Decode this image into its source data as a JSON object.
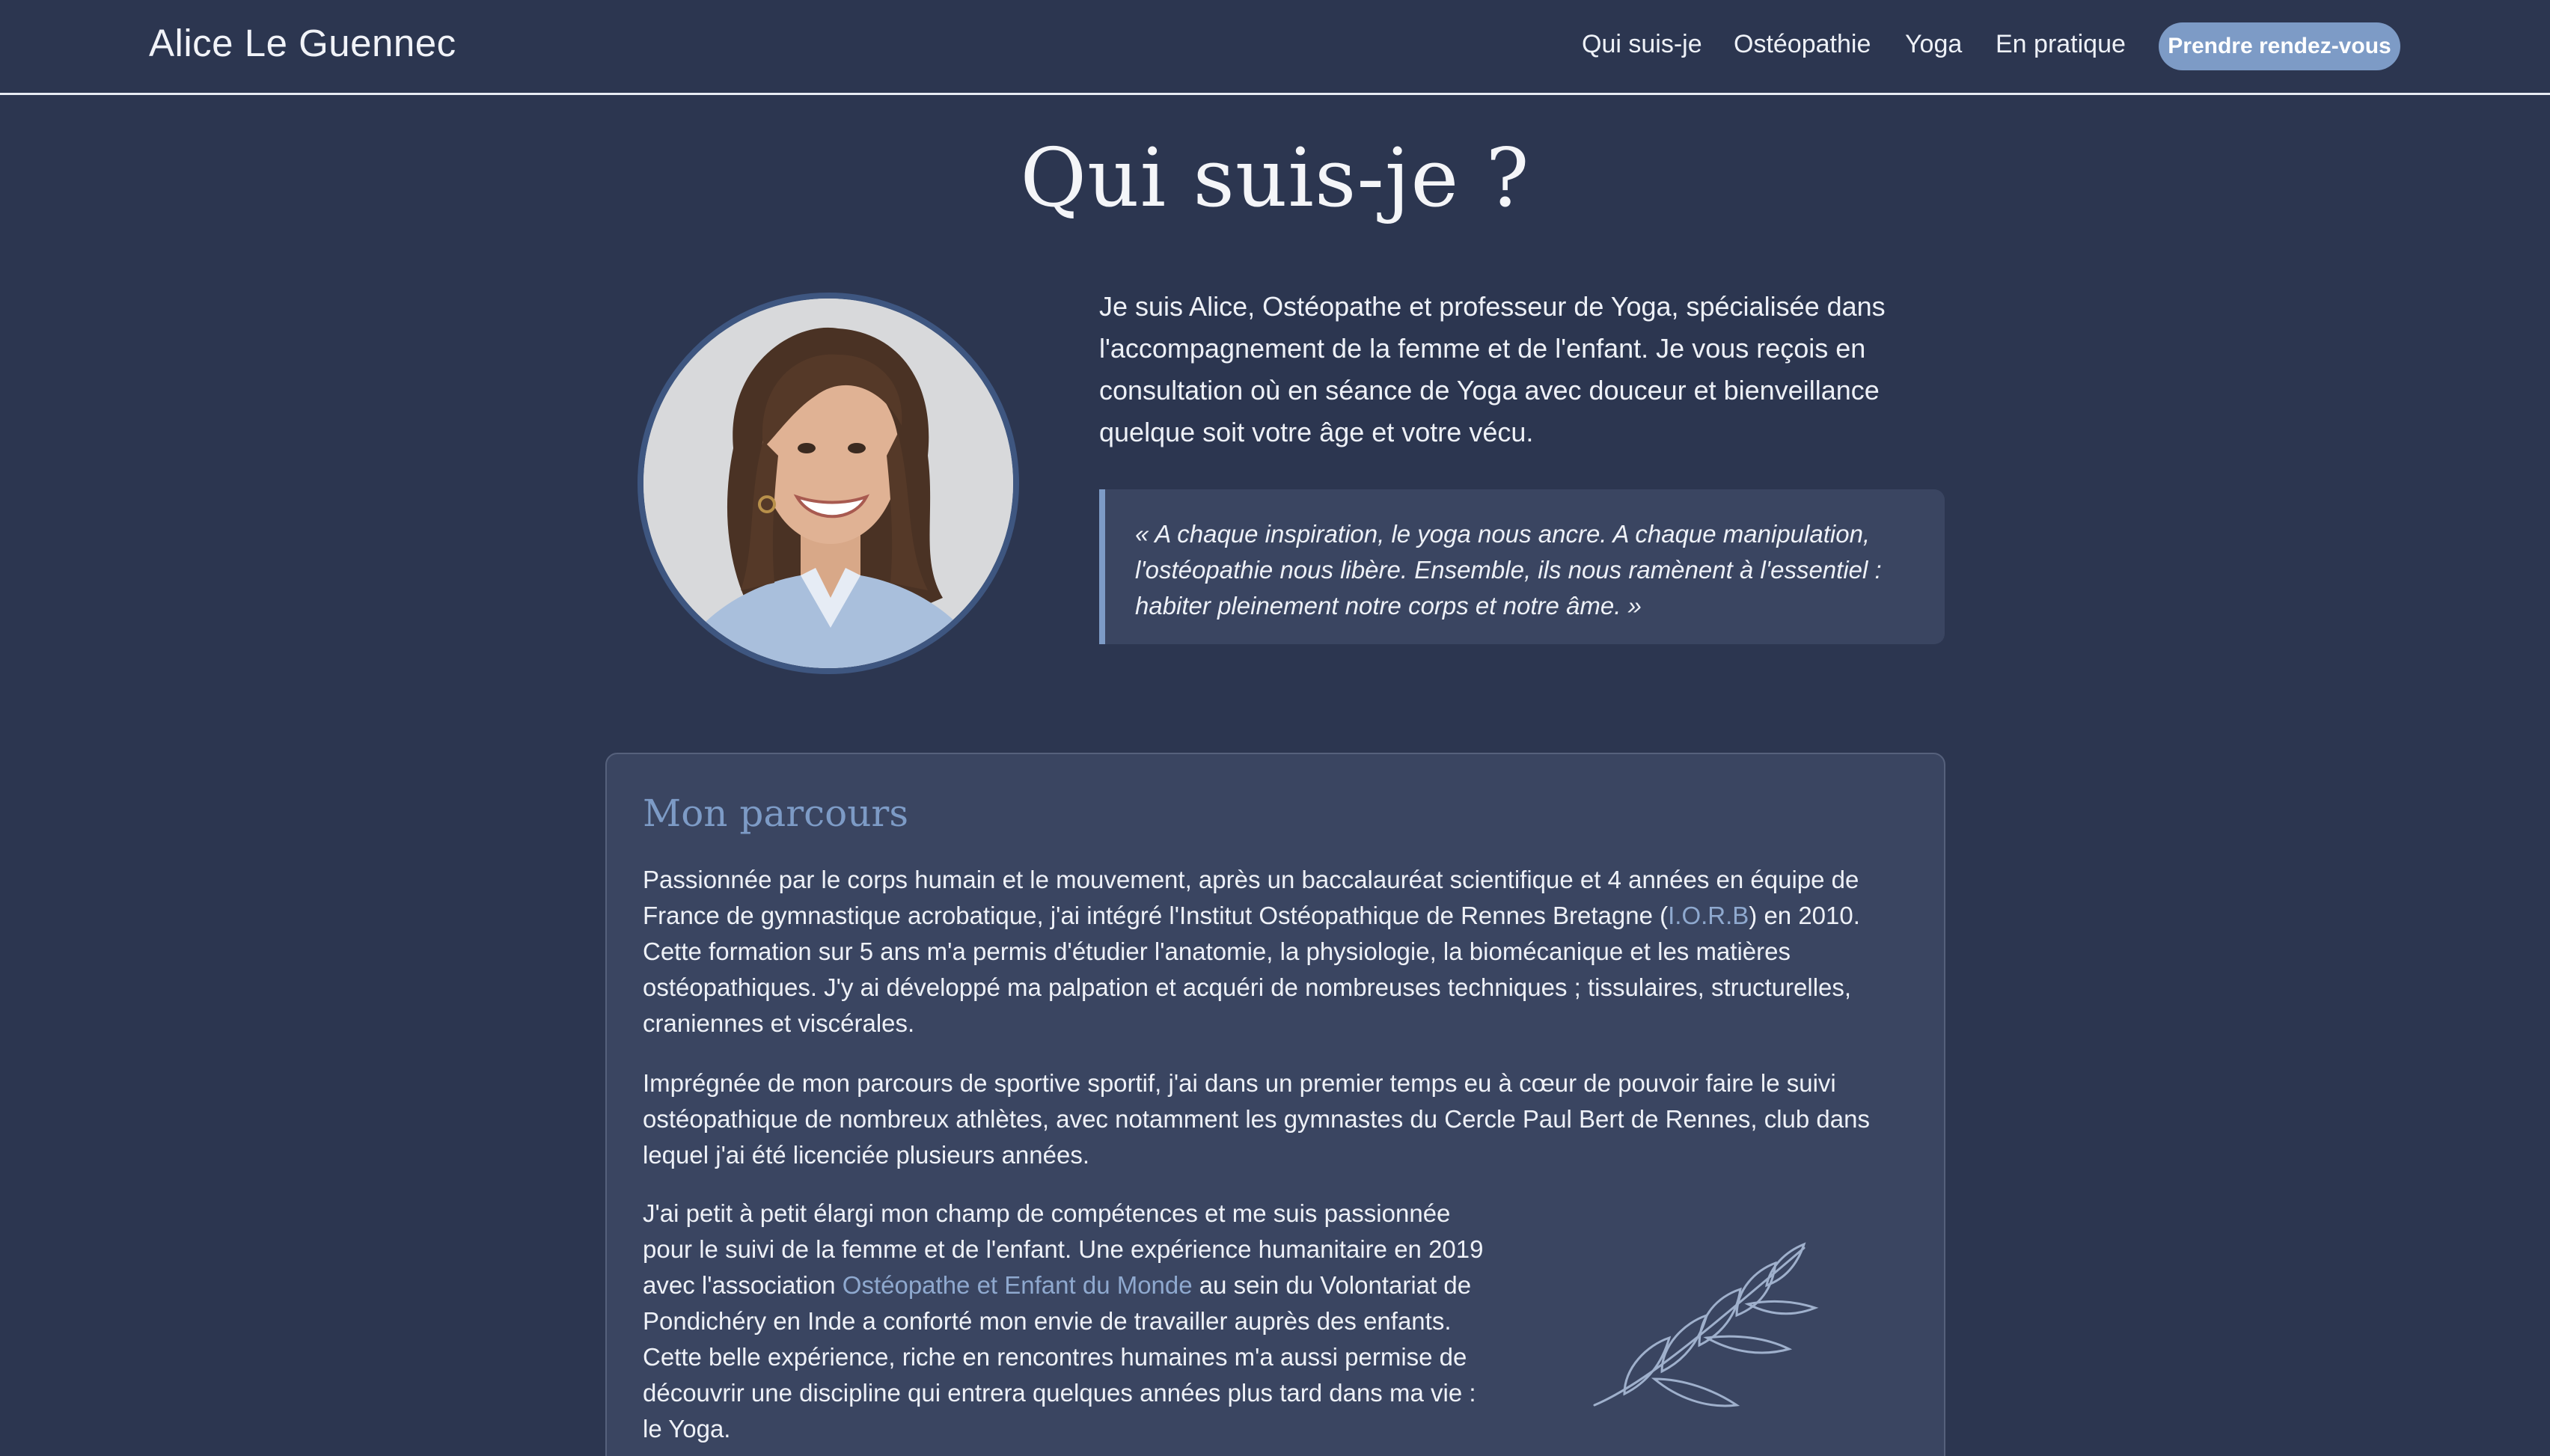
{
  "header": {
    "brand": "Alice Le Guennec",
    "nav": [
      "Qui suis-je",
      "Ostéopathie",
      "Yoga",
      "En pratique"
    ],
    "cta": "Prendre rendez-vous"
  },
  "page_title": "Qui suis-je ?",
  "intro": {
    "text": "Je suis Alice, Ostéopathe et professeur de Yoga, spécialisée dans l'accompagnement de la femme et de l'enfant. Je vous reçois en consultation où en séance de Yoga avec douceur et bienveillance quelque soit votre âge et votre vécu.",
    "quote": "« A chaque inspiration, le yoga nous ancre. A chaque manipulation, l'ostéopathie nous libère. Ensemble, ils nous ramènent à l'essentiel : habiter pleinement notre corps et notre âme. »"
  },
  "parcours": {
    "title": "Mon parcours",
    "p1_a": "Passionnée par le corps humain et le mouvement, après un baccalauréat scientifique et 4 années en équipe de France de gymnastique acrobatique, j'ai intégré l'Institut Ostéopathique de Rennes Bretagne (",
    "p1_link": "I.O.R.B",
    "p1_b": ") en 2010. Cette formation sur 5 ans m'a permis d'étudier l'anatomie, la physiologie, la biomécanique et les matières ostéopathiques. J'y ai développé ma palpation et acquéri de nombreuses techniques ; tissulaires, structurelles, craniennes et viscérales.",
    "p2": "Imprégnée de mon parcours de sportive sportif, j'ai dans un premier temps eu à cœur de pouvoir faire le suivi ostéopathique de nombreux athlètes, avec notamment les gymnastes du Cercle Paul Bert de Rennes, club dans lequel j'ai été licenciée plusieurs années.",
    "p3_a": "J'ai petit à petit élargi mon champ de compétences et me suis passionnée pour le suivi de la femme et de l'enfant. Une expérience humanitaire en 2019 avec l'association ",
    "p3_link": "Ostéopathe et Enfant du Monde",
    "p3_b": " au sein du Volontariat de Pondichéry en Inde a conforté mon envie de travailler auprès des enfants. Cette belle expérience, riche en rencontres humaines m'a aussi permise de découvrir une discipline qui entrera quelques années plus tard dans ma vie : le Yoga."
  },
  "colors": {
    "background": "#2c3650",
    "card": "#3a4561",
    "accent": "#7d9bc6",
    "text": "#eef1f7"
  },
  "icons": {
    "portrait": "portrait-photo",
    "branch": "leaf-branch-icon"
  }
}
